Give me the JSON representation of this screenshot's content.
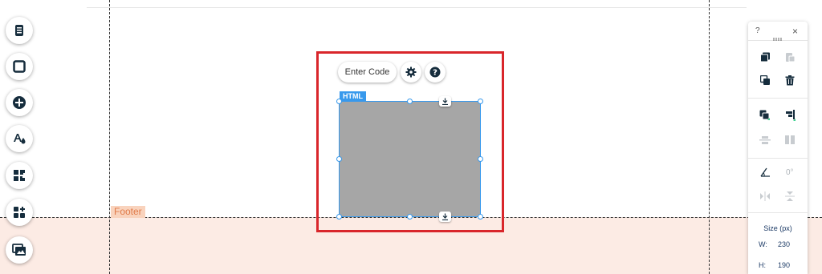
{
  "canvas": {
    "footer_label": "Footer"
  },
  "left_toolbar": {
    "items": [
      {
        "icon": "pages-icon"
      },
      {
        "icon": "background-icon"
      },
      {
        "icon": "add-icon"
      },
      {
        "icon": "design-icon"
      },
      {
        "icon": "app-market-icon"
      },
      {
        "icon": "add-apps-icon"
      },
      {
        "icon": "media-icon"
      }
    ]
  },
  "html_element": {
    "tag": "HTML",
    "enter_code_label": "Enter Code",
    "settings_icon": "gear-icon",
    "help_icon": "help-icon"
  },
  "right_panel": {
    "help": "?",
    "close": "×",
    "rotation": "0°",
    "size_label": "Size (px)",
    "width_label": "W:",
    "width_value": "230",
    "height_label": "H:",
    "height_value": "190"
  },
  "colors": {
    "highlight": "#d9262b",
    "selection": "#3899ec",
    "footer_bg": "#fcebe4",
    "footer_tag": "#e07b4a"
  }
}
